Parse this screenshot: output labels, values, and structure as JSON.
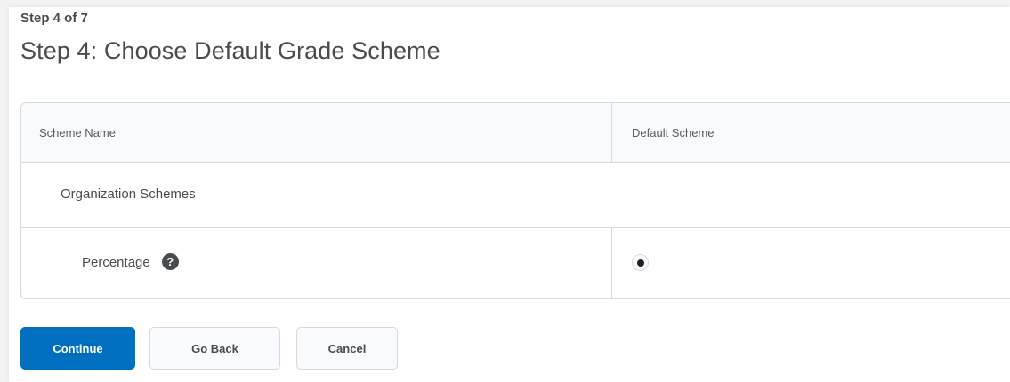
{
  "header": {
    "step_indicator": "Step 4 of 7",
    "title": "Step 4: Choose Default Grade Scheme"
  },
  "table": {
    "columns": [
      "Scheme Name",
      "Default Scheme"
    ],
    "groups": [
      {
        "label": "Organization Schemes",
        "items": [
          {
            "name": "Percentage",
            "has_help": true,
            "selected": true
          }
        ]
      }
    ]
  },
  "actions": {
    "continue_label": "Continue",
    "back_label": "Go Back",
    "cancel_label": "Cancel"
  },
  "colors": {
    "primary": "#006fbf",
    "text": "#494c4e",
    "border": "#d3d9e3"
  },
  "icons": {
    "help": "question-circle-icon",
    "radio": "radio-selected-icon"
  }
}
